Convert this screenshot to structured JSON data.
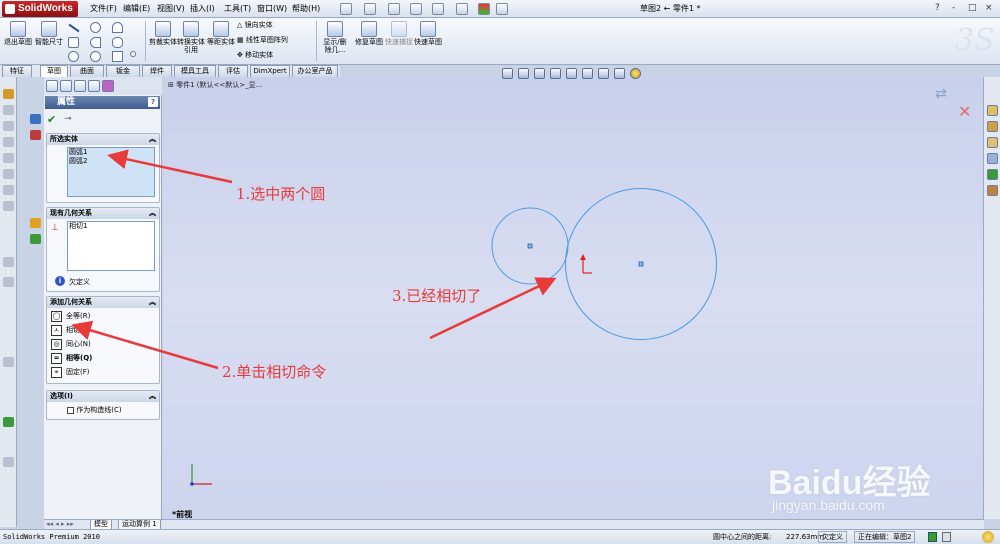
{
  "app": {
    "logo": "SolidWorks",
    "menus": [
      "文件(F)",
      "编辑(E)",
      "视图(V)",
      "插入(I)",
      "工具(T)",
      "窗口(W)",
      "帮助(H)"
    ],
    "doc_title": "草图2 ← 零件1 *",
    "window_buttons": [
      "?",
      "-",
      "□",
      "×"
    ]
  },
  "ribbon": {
    "exit_sketch": "退出草图",
    "smart_dim": "智能尺寸",
    "trim": "剪裁实体",
    "convert": "转换实体引用",
    "offset": "等距实体",
    "mirror": "镜向实体",
    "linear_pattern": "线性草图阵列",
    "move": "移动实体",
    "show_delete": "显示/删除几...",
    "repair": "修复草图",
    "quick_snap": "快速捕捉",
    "rapid_sketch": "快速草图"
  },
  "command_tabs": [
    "特征",
    "草图",
    "曲面",
    "钣金",
    "焊件",
    "模具工具",
    "评估",
    "DimXpert",
    "办公室产品"
  ],
  "pm": {
    "title": "属性",
    "help": "?",
    "selected_group": "所选实体",
    "selected_items": [
      "圆弧1",
      "圆弧2"
    ],
    "existing_group": "现有几何关系",
    "existing_items": [
      "相切1"
    ],
    "status": "欠定义",
    "add_group": "添加几何关系",
    "relations": [
      {
        "label": "全等(R)",
        "icon": "coradial-icon"
      },
      {
        "label": "相切(A)",
        "icon": "tangent-icon"
      },
      {
        "label": "同心(N)",
        "icon": "concentric-icon"
      },
      {
        "label": "相等(Q)",
        "icon": "equal-icon"
      },
      {
        "label": "固定(F)",
        "icon": "fix-icon"
      }
    ],
    "options_group": "选项(I)",
    "construction": "作为构造线(C)"
  },
  "canvas": {
    "crumb": "零件1  (默认<<默认>_显...",
    "view_label": "*前视"
  },
  "annotations": {
    "step1": "1.选中两个圆",
    "step2": "2.单击相切命令",
    "step3": "3.已经相切了"
  },
  "bottom_tabs": [
    "模型",
    "运动算例 1"
  ],
  "status": {
    "app_name": "SolidWorks Premium 2010",
    "measure_label": "圆中心之间的距离:",
    "measure_value": "227.63mm",
    "state": "欠定义",
    "editing": "正在编辑：草图2"
  },
  "watermark": {
    "text": "Baidu经验",
    "url": "jingyan.baidu.com"
  }
}
